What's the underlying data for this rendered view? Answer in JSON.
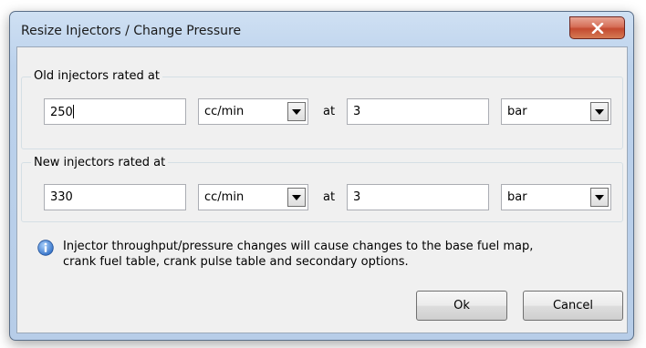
{
  "window": {
    "title": "Resize Injectors / Change Pressure",
    "close_icon": "close-x-icon"
  },
  "old_injectors": {
    "label": "Old injectors rated at",
    "flow_value": "250",
    "flow_unit": "cc/min",
    "at_label": "at",
    "pressure_value": "3",
    "pressure_unit": "bar"
  },
  "new_injectors": {
    "label": "New injectors rated at",
    "flow_value": "330",
    "flow_unit": "cc/min",
    "at_label": "at",
    "pressure_value": "3",
    "pressure_unit": "bar"
  },
  "info": {
    "icon": "info-icon",
    "line1": "Injector throughput/pressure changes will cause changes to the base fuel map,",
    "line2": "crank fuel table, crank pulse table and secondary options."
  },
  "buttons": {
    "ok": "Ok",
    "cancel": "Cancel"
  },
  "colors": {
    "title_bar": "#bcd2ec",
    "close_button": "#c44a30",
    "info_icon": "#3a7bd5",
    "client_bg": "#f0f0f0"
  }
}
